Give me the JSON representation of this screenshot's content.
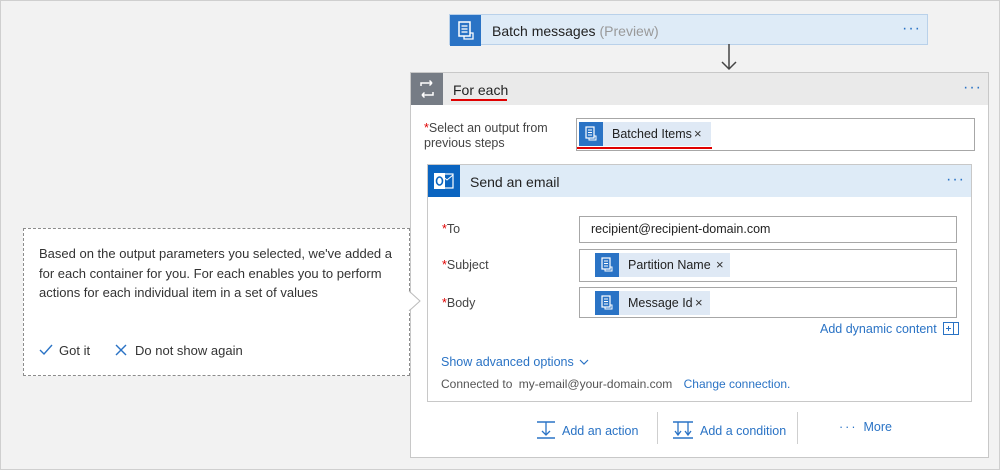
{
  "batch": {
    "title": "Batch messages",
    "preview": "(Preview)",
    "more": "···"
  },
  "foreach": {
    "title": "For each",
    "more": "···",
    "select_label_required": "*",
    "select_label": "Select an output from previous steps",
    "select_token": "Batched Items",
    "token_remove": "×"
  },
  "email": {
    "title": "Send an email",
    "more": "···",
    "to_label": "To",
    "to_value": "recipient@recipient-domain.com",
    "subject_label": "Subject",
    "subject_token": "Partition Name",
    "body_label": "Body",
    "body_token": "Message Id",
    "required_mark": "*",
    "remove": "×",
    "add_dynamic": "Add dynamic content",
    "show_advanced": "Show advanced options",
    "connected_prefix": "Connected to",
    "connected_account": "my-email@your-domain.com",
    "change_connection": "Change connection."
  },
  "actions": {
    "add_action": "Add an action",
    "add_condition": "Add a condition",
    "more": "More",
    "more_dots": "···"
  },
  "tip": {
    "message": "Based on the output parameters you selected, we've added a for each container for you. For each enables you to perform actions for each individual item in a set of values",
    "got_it": "Got it",
    "dismiss": "Do not show again"
  },
  "colors": {
    "accent": "#2a73c5",
    "required": "#e00000",
    "highlight": "#e00000"
  }
}
